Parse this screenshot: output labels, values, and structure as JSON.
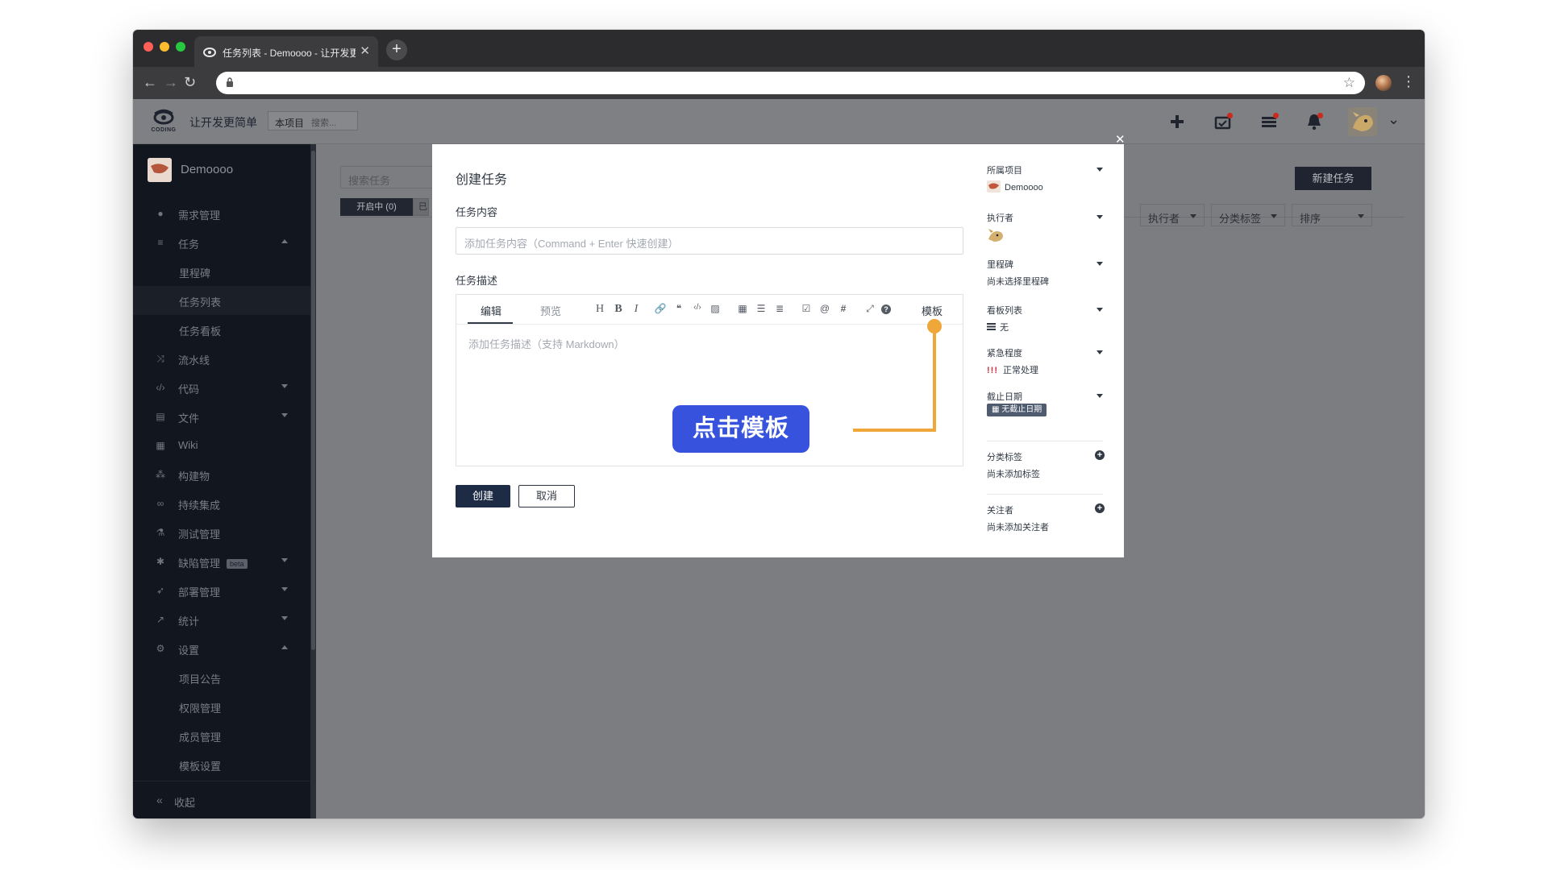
{
  "browser": {
    "tab_title": "任务列表 - Demoooo - 让开发更简单",
    "tab_close": "✕",
    "new_tab": "+",
    "back": "←",
    "forward": "→",
    "reload": "↻",
    "bookmark": "☆",
    "menu": "⋮"
  },
  "topbar": {
    "logo_text": "CODING",
    "slogan": "让开发更简单",
    "scope_label": "本项目",
    "search_placeholder": "搜索..."
  },
  "sidebar": {
    "project_name": "Demoooo",
    "items": [
      {
        "label": "需求管理",
        "icon": "lightbulb-icon",
        "glyph": "●"
      },
      {
        "label": "任务",
        "icon": "tasks-icon",
        "glyph": "≡"
      },
      {
        "label": "里程碑"
      },
      {
        "label": "任务列表"
      },
      {
        "label": "任务看板"
      },
      {
        "label": "流水线",
        "icon": "shuffle-icon",
        "glyph": "⤨"
      },
      {
        "label": "代码",
        "icon": "code-icon",
        "glyph": "‹/›"
      },
      {
        "label": "文件",
        "icon": "file-icon",
        "glyph": "▤"
      },
      {
        "label": "Wiki",
        "icon": "wiki-icon",
        "glyph": "▦"
      },
      {
        "label": "构建物",
        "icon": "cubes-icon",
        "glyph": "⁂"
      },
      {
        "label": "持续集成",
        "icon": "infinity-icon",
        "glyph": "∞"
      },
      {
        "label": "测试管理",
        "icon": "flask-icon",
        "glyph": "⚗"
      },
      {
        "label": "缺陷管理",
        "icon": "bug-icon",
        "glyph": "✱",
        "badge": "beta"
      },
      {
        "label": "部署管理",
        "icon": "rocket-icon",
        "glyph": "➶"
      },
      {
        "label": "统计",
        "icon": "chart-icon",
        "glyph": "↗"
      },
      {
        "label": "设置",
        "icon": "cogs-icon",
        "glyph": "⚙"
      },
      {
        "label": "项目公告"
      },
      {
        "label": "权限管理"
      },
      {
        "label": "成员管理"
      },
      {
        "label": "模板设置"
      }
    ],
    "collapse_label": "收起",
    "collapse_glyph": "«"
  },
  "background": {
    "search_placeholder": "搜索任务",
    "tab_open": "开启中 (0)",
    "tab_other": "已",
    "new_task": "新建任务",
    "filters": [
      "执行者",
      "分类标签",
      "排序"
    ]
  },
  "modal": {
    "close": "✕",
    "title": "创建任务",
    "content_label": "任务内容",
    "content_placeholder": "添加任务内容（Command + Enter 快速创建）",
    "desc_label": "任务描述",
    "editor_tab_edit": "编辑",
    "editor_tab_preview": "预览",
    "toolbar": {
      "heading": "H",
      "bold": "B",
      "italic": "I",
      "link": "🔗",
      "quote": "❝",
      "code": "‹/›",
      "image": "▨",
      "table": "▦",
      "ordered_list": "☰",
      "unordered_list": "≣",
      "checkbox": "☑",
      "mention": "@",
      "hash": "#",
      "fullscreen": "⤢",
      "help": "?"
    },
    "template_label": "模板",
    "desc_placeholder": "添加任务描述（支持 Markdown）",
    "callout": "点击模板",
    "create_button": "创建",
    "cancel_button": "取消",
    "side": {
      "project_label": "所属项目",
      "project_value": "Demoooo",
      "assignee_label": "执行者",
      "milestone_label": "里程碑",
      "milestone_value": "尚未选择里程碑",
      "board_label": "看板列表",
      "board_value": "无",
      "priority_label": "紧急程度",
      "priority_mark": "!!!",
      "priority_value": "正常处理",
      "due_label": "截止日期",
      "due_value": "无截止日期",
      "tags_label": "分类标签",
      "tags_value": "尚未添加标签",
      "watchers_label": "关注者",
      "watchers_value": "尚未添加关注者"
    }
  },
  "colors": {
    "accent_callout": "#3752dc",
    "guide_orange": "#f0a73a",
    "sidebar_bg": "#12161f",
    "create_btn": "#1d2b45"
  }
}
